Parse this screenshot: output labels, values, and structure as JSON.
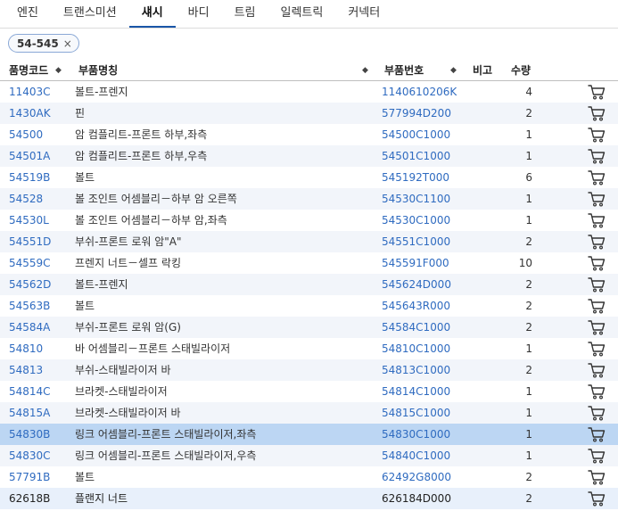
{
  "tabs": [
    {
      "label": "엔진",
      "active": false
    },
    {
      "label": "트랜스미션",
      "active": false
    },
    {
      "label": "섀시",
      "active": true
    },
    {
      "label": "바디",
      "active": false
    },
    {
      "label": "트림",
      "active": false
    },
    {
      "label": "일렉트릭",
      "active": false
    },
    {
      "label": "커넥터",
      "active": false
    }
  ],
  "filter_chip": {
    "label": "54-545",
    "remove_glyph": "×"
  },
  "columns": {
    "code": "품명코드",
    "name": "부품명칭",
    "part_no": "부품번호",
    "remark": "비고",
    "qty": "수량"
  },
  "sort_glyph": "◆",
  "icons": {
    "sort": "sort-icon",
    "cart": "cart-icon"
  },
  "colors": {
    "link": "#2f6bc0",
    "selected_row": "#bcd6f3",
    "alt_row": "#f2f5fa",
    "active_tab_underline": "#1a56a8"
  },
  "rows": [
    {
      "code": "11403C",
      "name": "볼트-프렌지",
      "part_no": "1140610206K",
      "remark": "",
      "qty": "4"
    },
    {
      "code": "1430AK",
      "name": "핀",
      "part_no": "577994D200",
      "remark": "",
      "qty": "2"
    },
    {
      "code": "54500",
      "name": "암 컴플리트-프론트 하부,좌측",
      "part_no": "54500C1000",
      "remark": "",
      "qty": "1"
    },
    {
      "code": "54501A",
      "name": "암 컴플리트-프론트 하부,우측",
      "part_no": "54501C1000",
      "remark": "",
      "qty": "1"
    },
    {
      "code": "54519B",
      "name": "볼트",
      "part_no": "54519​2T000",
      "remark": "",
      "qty": "6"
    },
    {
      "code": "54528",
      "name": "볼 조인트 어셈블리－하부 암 오른쪽",
      "part_no": "54530C1100",
      "remark": "",
      "qty": "1"
    },
    {
      "code": "54530L",
      "name": "볼 조인트 어셈블리－하부 암,좌측",
      "part_no": "54530C1000",
      "remark": "",
      "qty": "1"
    },
    {
      "code": "54551D",
      "name": "부쉬-프론트 로워 암\"A\"",
      "part_no": "54551C1000",
      "remark": "",
      "qty": "2"
    },
    {
      "code": "54559C",
      "name": "프렌지 너트－셀프 락킹",
      "part_no": "545591F000",
      "remark": "",
      "qty": "10"
    },
    {
      "code": "54562D",
      "name": "볼트-프렌지",
      "part_no": "545624D000",
      "remark": "",
      "qty": "2"
    },
    {
      "code": "54563B",
      "name": "볼트",
      "part_no": "545643R000",
      "remark": "",
      "qty": "2"
    },
    {
      "code": "54584A",
      "name": "부쉬-프론트 로워 암(G)",
      "part_no": "54584C1000",
      "remark": "",
      "qty": "2"
    },
    {
      "code": "54810",
      "name": "바 어셈블리－프론트 스태빌라이저",
      "part_no": "54810C1000",
      "remark": "",
      "qty": "1"
    },
    {
      "code": "54813",
      "name": "부쉬-스태빌라이저 바",
      "part_no": "54813C1000",
      "remark": "",
      "qty": "2"
    },
    {
      "code": "54814C",
      "name": "브라켓-스태빌라이저",
      "part_no": "54814C1000",
      "remark": "",
      "qty": "1"
    },
    {
      "code": "54815A",
      "name": "브라켓-스태빌라이저 바",
      "part_no": "54815C1000",
      "remark": "",
      "qty": "1"
    },
    {
      "code": "54830B",
      "name": "링크 어셈블리-프론트 스태빌라이저,좌측",
      "part_no": "54830C1000",
      "remark": "",
      "qty": "1"
    },
    {
      "code": "54830C",
      "name": "링크 어셈블리-프론트 스태빌라이저,우측",
      "part_no": "54840C1000",
      "remark": "",
      "qty": "1"
    },
    {
      "code": "57791B",
      "name": "볼트",
      "part_no": "62492G8000",
      "remark": "",
      "qty": "2"
    },
    {
      "code": "62618B",
      "name": "플랜지 너트",
      "part_no": "626184D000",
      "remark": "",
      "qty": "2"
    }
  ]
}
